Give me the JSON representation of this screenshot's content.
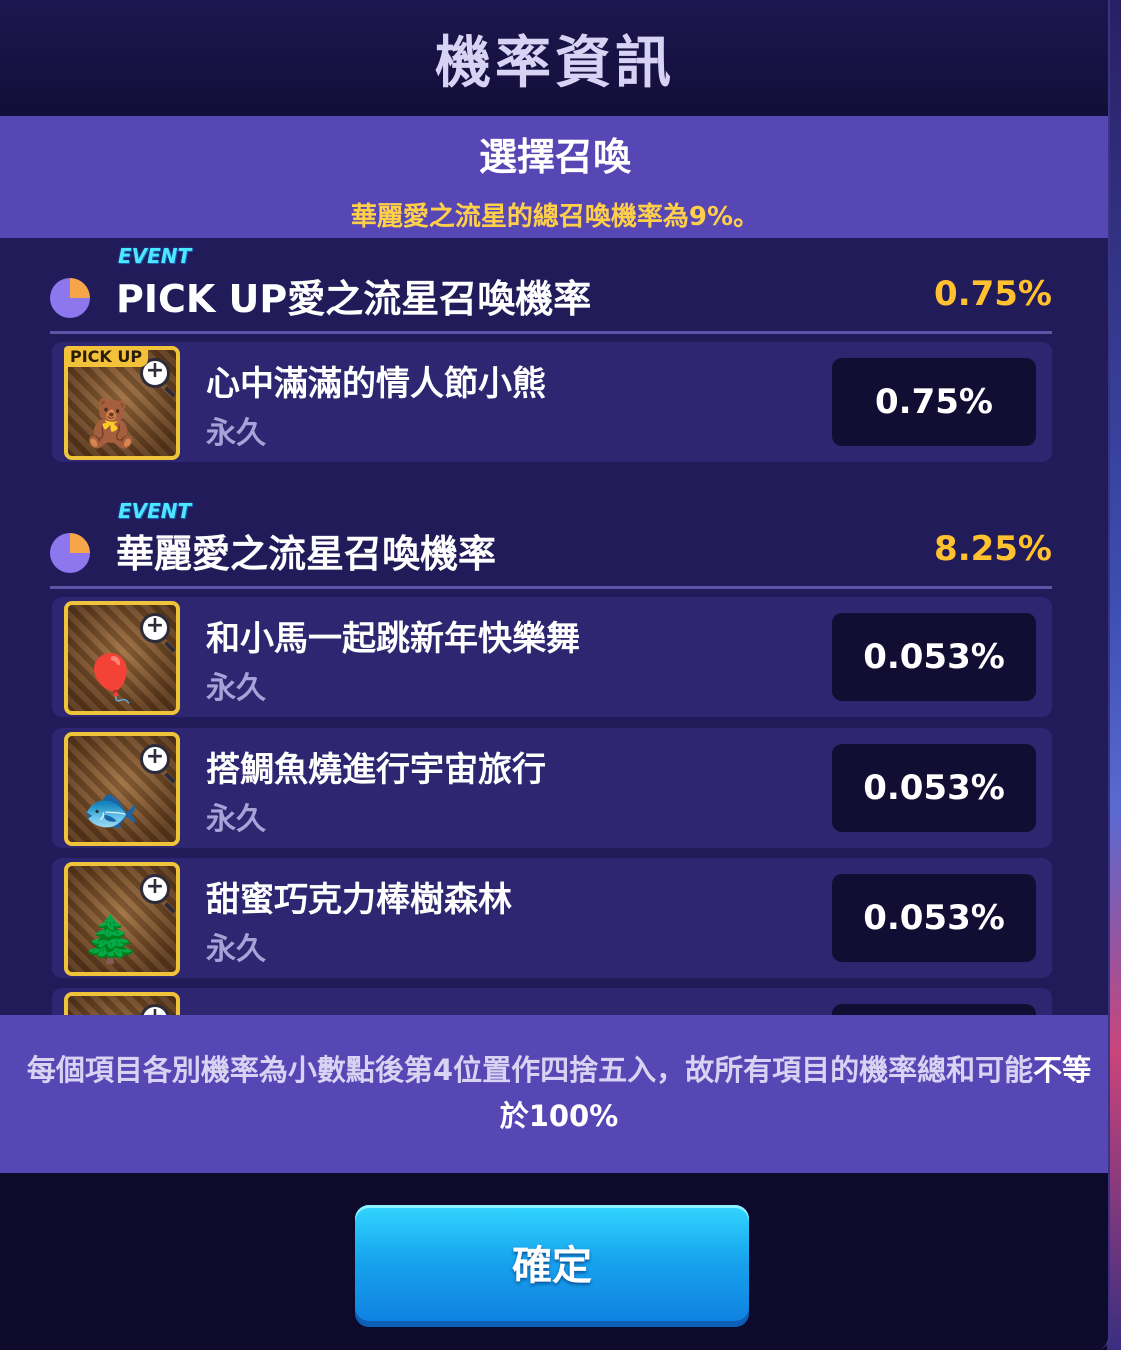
{
  "dialog": {
    "title": "機率資訊",
    "sub_title": "選擇召喚",
    "sub_note": "華麗愛之流星的總召喚機率為9%。"
  },
  "sections": [
    {
      "event_tag": "EVENT",
      "title": "PICK UP愛之流星召喚機率",
      "rate": "0.75%",
      "icon": "pie-chart-icon",
      "items": [
        {
          "name": "心中滿滿的情人節小熊",
          "duration": "永久",
          "rate": "0.75%",
          "badge": "PICK UP",
          "art": "teddy-bear-chocolate-heart"
        }
      ]
    },
    {
      "event_tag": "EVENT",
      "title": "華麗愛之流星召喚機率",
      "rate": "8.25%",
      "icon": "pie-chart-icon",
      "items": [
        {
          "name": "和小馬一起跳新年快樂舞",
          "duration": "永久",
          "rate": "0.053%",
          "art": "pony-with-balloons"
        },
        {
          "name": "搭鯛魚燒進行宇宙旅行",
          "duration": "永久",
          "rate": "0.053%",
          "art": "taiyaki-fish"
        },
        {
          "name": "甜蜜巧克力棒樹森林",
          "duration": "永久",
          "rate": "0.053%",
          "art": "chocolate-stick-forest"
        }
      ]
    }
  ],
  "footer": {
    "note_part1": "每個項目各別機率為小數點後第4位置作四捨五入，故所有項目的機率總和可能",
    "note_highlight": "不等於100%"
  },
  "confirm_button": {
    "label": "確定"
  },
  "colors": {
    "accent_gold": "#ffc22e",
    "event_cyan": "#4de8ff",
    "header_purple": "#5747b5",
    "button_blue": "#17a4ee"
  }
}
